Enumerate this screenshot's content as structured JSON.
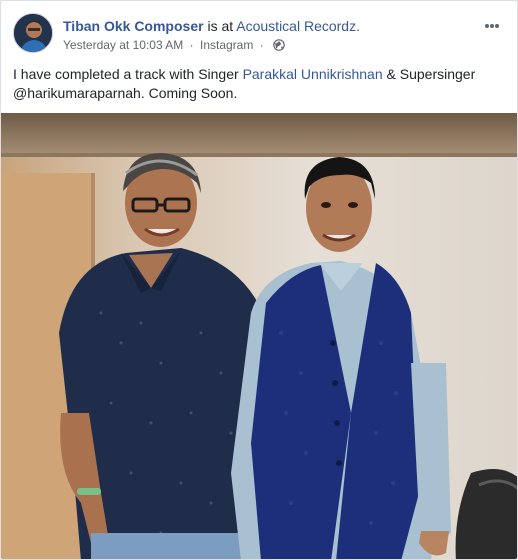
{
  "post": {
    "author": "Tiban Okk Composer",
    "is_at": "is at",
    "place": "Acoustical Recordz.",
    "time": "Yesterday at 10:03 AM",
    "separator": "·",
    "source": "Instagram",
    "privacy_icon": "globe-icon",
    "more_icon": "more-options-icon",
    "text_1": "I have completed a track with Singer ",
    "tagged_person": "Parakkal Unnikrishnan",
    "text_2": " & Supersinger @harikumaraparnah. Coming Soon."
  },
  "colors": {
    "link": "#365899",
    "meta": "#616770"
  }
}
